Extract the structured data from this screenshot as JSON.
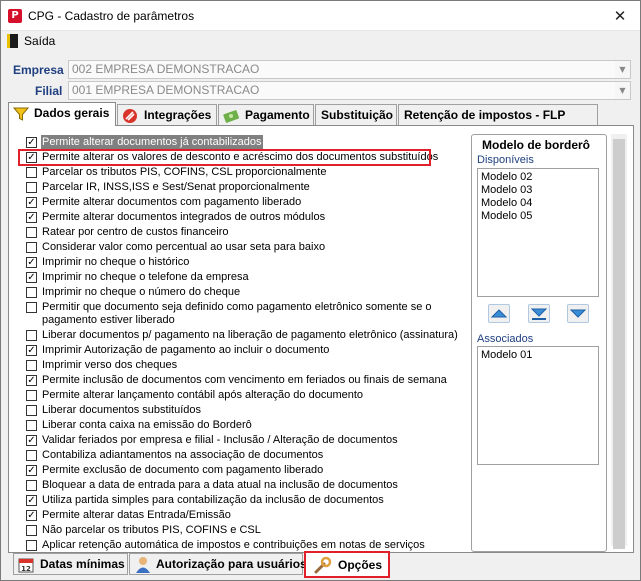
{
  "window": {
    "title": "CPG - Cadastro de parâmetros",
    "close_glyph": "✕"
  },
  "menu": {
    "exit_label": "Saída",
    "exit_icon": "exit-door-icon"
  },
  "fields": {
    "empresa_label": "Empresa",
    "empresa_value": "002 EMPRESA DEMONSTRACAO",
    "filial_label": "Filial",
    "filial_value": "001 EMPRESA DEMONSTRACAO"
  },
  "tabs": [
    {
      "label": "Dados gerais",
      "icon": "funnel-icon",
      "active": true
    },
    {
      "label": "Integrações",
      "icon": "integration-icon",
      "active": false
    },
    {
      "label": "Pagamento",
      "icon": "money-icon",
      "active": false
    },
    {
      "label": "Substituição",
      "icon": "",
      "active": false
    },
    {
      "label": "Retenção de impostos - FLP",
      "icon": "",
      "active": false
    }
  ],
  "checklist": [
    {
      "label": "Permite alterar documentos já contabilizados",
      "checked": true
    },
    {
      "label": "Permite alterar os valores de desconto e acréscimo dos documentos substituídos",
      "checked": true
    },
    {
      "label": "Parcelar os tributos PIS, COFINS, CSL proporcionalmente",
      "checked": false
    },
    {
      "label": "Parcelar IR, INSS,ISS e Sest/Senat proporcionalmente",
      "checked": false
    },
    {
      "label": "Permite alterar documentos com pagamento liberado",
      "checked": true
    },
    {
      "label": "Permite alterar documentos integrados de outros módulos",
      "checked": true
    },
    {
      "label": "Ratear por centro de custos financeiro",
      "checked": false
    },
    {
      "label": "Considerar valor como percentual ao usar seta para baixo",
      "checked": false
    },
    {
      "label": "Imprimir no cheque o histórico",
      "checked": true
    },
    {
      "label": "Imprimir no cheque o telefone da empresa",
      "checked": true
    },
    {
      "label": "Imprimir no cheque o número do cheque",
      "checked": false
    },
    {
      "label": "Permitir que documento seja definido como pagamento eletrônico somente se o pagamento estiver liberado",
      "checked": false
    },
    {
      "label": "Liberar documentos p/ pagamento na liberação de pagamento eletrônico (assinatura)",
      "checked": false
    },
    {
      "label": "Imprimir Autorização de pagamento ao incluir o documento",
      "checked": true
    },
    {
      "label": "Imprimir verso dos cheques",
      "checked": false
    },
    {
      "label": "Permite inclusão de documentos com vencimento em feriados ou finais de semana",
      "checked": true
    },
    {
      "label": "Permite alterar lançamento contábil após alteração do documento",
      "checked": false
    },
    {
      "label": "Liberar documentos substituídos",
      "checked": false
    },
    {
      "label": "Liberar conta caixa na emissão do Borderô",
      "checked": false
    },
    {
      "label": "Validar feriados por empresa e filial - Inclusão / Alteração de documentos",
      "checked": true
    },
    {
      "label": "Contabiliza adiantamentos na associação de documentos",
      "checked": false
    },
    {
      "label": "Permite exclusão de documento com pagamento liberado",
      "checked": true
    },
    {
      "label": "Bloquear a data de entrada para a data atual na inclusão de documentos",
      "checked": false
    },
    {
      "label": "Utiliza partida simples para contabilização da inclusão de documentos",
      "checked": true
    },
    {
      "label": "Permite alterar datas Entrada/Emissão",
      "checked": true
    },
    {
      "label": "Não parcelar os tributos PIS, COFINS e CSL",
      "checked": false
    },
    {
      "label": "Aplicar retenção automática de impostos e contribuições em notas de serviços",
      "checked": false
    }
  ],
  "bordero": {
    "title": "Modelo de borderô",
    "available_label": "Disponíveis",
    "available": [
      "Modelo 02",
      "Modelo 03",
      "Modelo 04",
      "Modelo 05"
    ],
    "associated_label": "Associados",
    "associated": [
      "Modelo 01"
    ],
    "buttons": [
      "arrow-up-icon",
      "arrow-down-bar-icon",
      "arrow-down-icon"
    ]
  },
  "bottom_tabs": [
    {
      "label": "Datas mínimas",
      "icon": "calendar-icon"
    },
    {
      "label": "Autorização para usuários",
      "icon": "user-icon"
    },
    {
      "label": "Opções",
      "icon": "wrench-icon",
      "active": true
    }
  ],
  "colors": {
    "highlight": "#e0202a",
    "label_blue": "#1f3f80"
  }
}
